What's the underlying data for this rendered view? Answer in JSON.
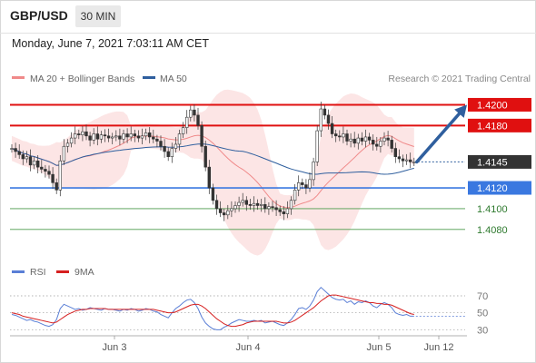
{
  "header": {
    "pair": "GBP/USD",
    "timeframe": "30 MIN"
  },
  "datetime": "Monday, June 7, 2021 7:03:11 AM CET",
  "legend": {
    "ma20": {
      "label": "MA 20 + Bollinger Bands",
      "color": "#f08a8a"
    },
    "ma50": {
      "label": "MA 50",
      "color": "#2f5f9e"
    }
  },
  "credit": "Research © 2021 Trading Central",
  "chart_data": [
    {
      "type": "candlestick",
      "title": "",
      "ylim": [
        1.4065,
        1.421
      ],
      "x_labels": [
        "Jun 3",
        "Jun 4",
        "Jun 5",
        "Jun 12"
      ],
      "levels": [
        {
          "value": 1.42,
          "label": "1.4200",
          "kind": "resistance",
          "color": "#e01010"
        },
        {
          "value": 1.418,
          "label": "1.4180",
          "kind": "resistance",
          "color": "#e01010"
        },
        {
          "value": 1.4145,
          "label": "1.4145",
          "kind": "last-price",
          "color": "#333333"
        },
        {
          "value": 1.412,
          "label": "1.4120",
          "kind": "pivot",
          "color": "#3a78e0"
        },
        {
          "value": 1.41,
          "label": "1.4100",
          "kind": "support",
          "color": "#4a9a4a"
        },
        {
          "value": 1.408,
          "label": "1.4080",
          "kind": "support",
          "color": "#4a9a4a"
        }
      ],
      "close_series": [
        1.4158,
        1.4155,
        1.4152,
        1.4148,
        1.415,
        1.4142,
        1.4146,
        1.414,
        1.4138,
        1.4136,
        1.4133,
        1.4125,
        1.4118,
        1.4146,
        1.416,
        1.4163,
        1.4168,
        1.4172,
        1.4171,
        1.4174,
        1.417,
        1.4166,
        1.4172,
        1.4167,
        1.4171,
        1.417,
        1.4168,
        1.4169,
        1.417,
        1.4167,
        1.4172,
        1.4169,
        1.4172,
        1.417,
        1.4168,
        1.417,
        1.4173,
        1.4169,
        1.4167,
        1.4165,
        1.416,
        1.4155,
        1.415,
        1.4158,
        1.4162,
        1.4172,
        1.4178,
        1.4188,
        1.4195,
        1.419,
        1.418,
        1.416,
        1.414,
        1.412,
        1.4108,
        1.41,
        1.4096,
        1.4094,
        1.4098,
        1.41,
        1.4103,
        1.4106,
        1.4108,
        1.4104,
        1.4103,
        1.4105,
        1.4103,
        1.4104,
        1.41,
        1.4102,
        1.4101,
        1.4099,
        1.4097,
        1.4095,
        1.41,
        1.4108,
        1.4118,
        1.4125,
        1.4123,
        1.412,
        1.4128,
        1.4145,
        1.4175,
        1.4196,
        1.419,
        1.4182,
        1.4172,
        1.417,
        1.4169,
        1.4172,
        1.4165,
        1.4167,
        1.4163,
        1.4168,
        1.4165,
        1.4169,
        1.4166,
        1.4162,
        1.416,
        1.4165,
        1.4168,
        1.4166,
        1.4158,
        1.415,
        1.4148,
        1.4146,
        1.4147,
        1.4145,
        1.4145
      ],
      "arrow": {
        "from_value": 1.4145,
        "to_value": 1.42,
        "direction": "up"
      }
    },
    {
      "type": "line",
      "title": "",
      "series": [
        {
          "name": "RSI",
          "color": "#5a7fd6",
          "values": [
            48,
            47,
            45,
            43,
            41,
            42,
            40,
            39,
            37,
            35,
            34,
            36,
            42,
            55,
            60,
            58,
            56,
            54,
            55,
            53,
            54,
            56,
            55,
            54,
            53,
            55,
            54,
            54,
            53,
            52,
            54,
            53,
            55,
            54,
            52,
            53,
            55,
            54,
            52,
            51,
            48,
            46,
            44,
            50,
            55,
            58,
            62,
            65,
            66,
            62,
            55,
            45,
            38,
            34,
            31,
            30,
            30,
            33,
            35,
            38,
            40,
            42,
            41,
            40,
            40,
            41,
            40,
            41,
            38,
            39,
            40,
            38,
            36,
            35,
            38,
            42,
            48,
            55,
            56,
            54,
            58,
            65,
            75,
            80,
            76,
            72,
            68,
            66,
            65,
            66,
            62,
            64,
            60,
            63,
            62,
            64,
            62,
            58,
            56,
            60,
            62,
            60,
            56,
            50,
            48,
            47,
            48,
            46,
            46
          ]
        },
        {
          "name": "9MA",
          "color": "#d62020",
          "values": [
            50,
            49,
            48,
            46,
            45,
            44,
            43,
            42,
            41,
            40,
            39,
            38,
            39,
            42,
            45,
            48,
            50,
            52,
            53,
            54,
            54,
            55,
            55,
            55,
            55,
            55,
            54,
            54,
            54,
            54,
            54,
            54,
            54,
            54,
            54,
            54,
            54,
            54,
            54,
            53,
            52,
            51,
            50,
            50,
            51,
            53,
            55,
            57,
            59,
            60,
            60,
            58,
            55,
            51,
            47,
            43,
            40,
            37,
            35,
            34,
            34,
            35,
            36,
            38,
            39,
            40,
            40,
            40,
            40,
            40,
            40,
            40,
            39,
            38,
            38,
            39,
            41,
            44,
            47,
            50,
            53,
            56,
            60,
            64,
            67,
            70,
            71,
            71,
            70,
            69,
            68,
            67,
            66,
            65,
            64,
            63,
            62,
            62,
            61,
            61,
            60,
            60,
            59,
            57,
            55,
            53,
            51,
            49,
            48
          ]
        }
      ],
      "yticks": [
        30,
        50,
        70
      ],
      "ylim": [
        25,
        85
      ]
    }
  ]
}
